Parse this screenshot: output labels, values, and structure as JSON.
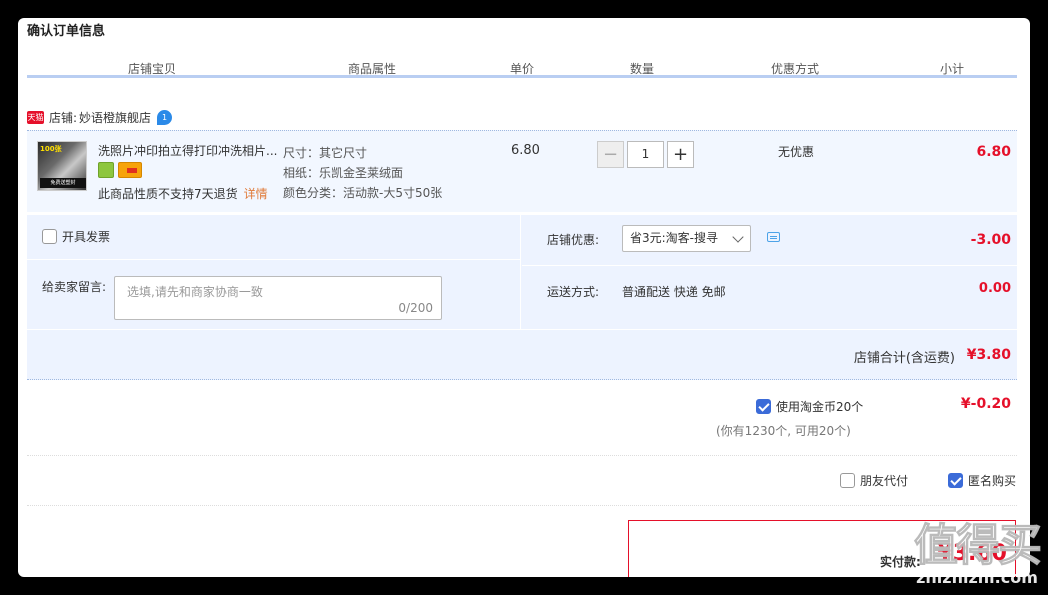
{
  "page_title": "确认订单信息",
  "table_headers": [
    "店铺宝贝",
    "商品属性",
    "单价",
    "数量",
    "优惠方式",
    "小计"
  ],
  "shop": {
    "badge": "天猫",
    "label": "店铺:",
    "name": "妙语橙旗舰店"
  },
  "item": {
    "thumb_text_top": "100张",
    "thumb_text_bottom": "免费送塑封",
    "name": "洗照片冲印拍立得打印冲洗相片...",
    "no_return": "此商品性质不支持7天退货",
    "detail_link": "详情",
    "attrs": [
      "尺寸：其它尺寸",
      "相纸：乐凯金圣莱绒面",
      "颜色分类：活动款-大5寸50张"
    ],
    "price": "6.80",
    "quantity": "1",
    "minus": "−",
    "plus": "+",
    "promo": "无优惠",
    "subtotal": "6.80"
  },
  "options": {
    "invoice_label": "开具发票",
    "message_label": "给卖家留言:",
    "message_placeholder": "选填,请先和商家协商一致",
    "message_count": "0/200",
    "shop_discount_label": "店铺优惠:",
    "shop_discount_selected": "省3元:淘客-搜寻",
    "shop_discount_amount": "-3.00",
    "shipping_label": "运送方式:",
    "shipping_value": "普通配送 快递 免邮",
    "shipping_fee": "0.00"
  },
  "shop_total": {
    "label": "店铺合计(含运费)",
    "value": "¥3.80"
  },
  "coins": {
    "label": "使用淘金币20个",
    "checked": true,
    "amount": "¥-0.20",
    "note": "(你有1230个, 可用20个)"
  },
  "friend_pay": {
    "label": "朋友代付",
    "checked": false
  },
  "anon_buy": {
    "label": "匿名购买",
    "checked": true
  },
  "payment": {
    "label": "实付款:",
    "amount": "¥3.60"
  },
  "watermark": {
    "logo": "值得买",
    "url": "zhizhizhi.com"
  },
  "colors": {
    "accent_red": "#e5102a",
    "header_line": "#b9cef2",
    "panel_blue": "#edf3ff",
    "checkbox_blue": "#3b6bd8"
  }
}
